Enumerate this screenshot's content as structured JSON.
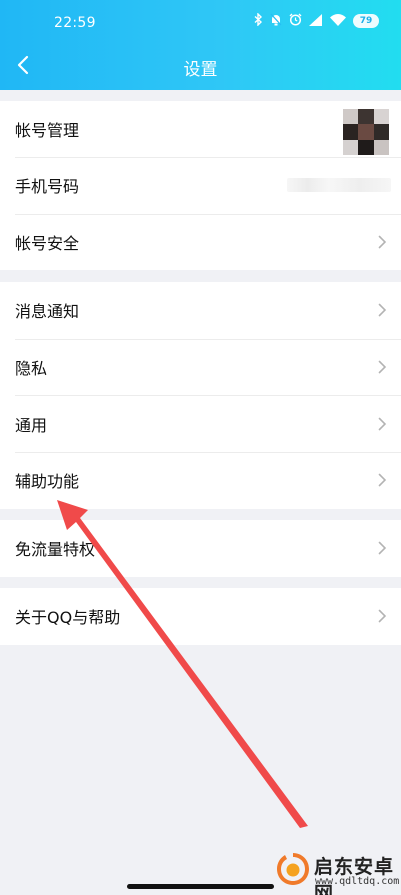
{
  "status_bar": {
    "time": "22:59",
    "battery": "79",
    "icons": [
      "bluetooth-icon",
      "mute-icon",
      "alarm-icon",
      "signal-icon",
      "wifi-icon",
      "battery-icon"
    ]
  },
  "nav": {
    "title": "设置",
    "back_icon": "chevron-left-icon"
  },
  "groups": [
    {
      "items": [
        {
          "label": "帐号管理",
          "accessory": "avatar"
        },
        {
          "label": "手机号码",
          "accessory": "blurred-value"
        },
        {
          "label": "帐号安全",
          "accessory": "chevron-right-icon"
        }
      ]
    },
    {
      "items": [
        {
          "label": "消息通知",
          "accessory": "chevron-right-icon"
        },
        {
          "label": "隐私",
          "accessory": "chevron-right-icon"
        },
        {
          "label": "通用",
          "accessory": "chevron-right-icon"
        },
        {
          "label": "辅助功能",
          "accessory": "chevron-right-icon"
        }
      ]
    },
    {
      "items": [
        {
          "label": "免流量特权",
          "accessory": "chevron-right-icon"
        }
      ]
    },
    {
      "items": [
        {
          "label": "关于QQ与帮助",
          "accessory": "chevron-right-icon"
        }
      ]
    }
  ],
  "annotation": {
    "color": "#f04a4a",
    "points_to": "辅助功能"
  },
  "watermark": {
    "title": "启东安卓网",
    "url": "www.qdltdq.com"
  },
  "colors": {
    "header_start": "#20b7f5",
    "header_end": "#22ddf0",
    "page_background": "#f0f1f5",
    "chevron": "#b3b3b3"
  }
}
